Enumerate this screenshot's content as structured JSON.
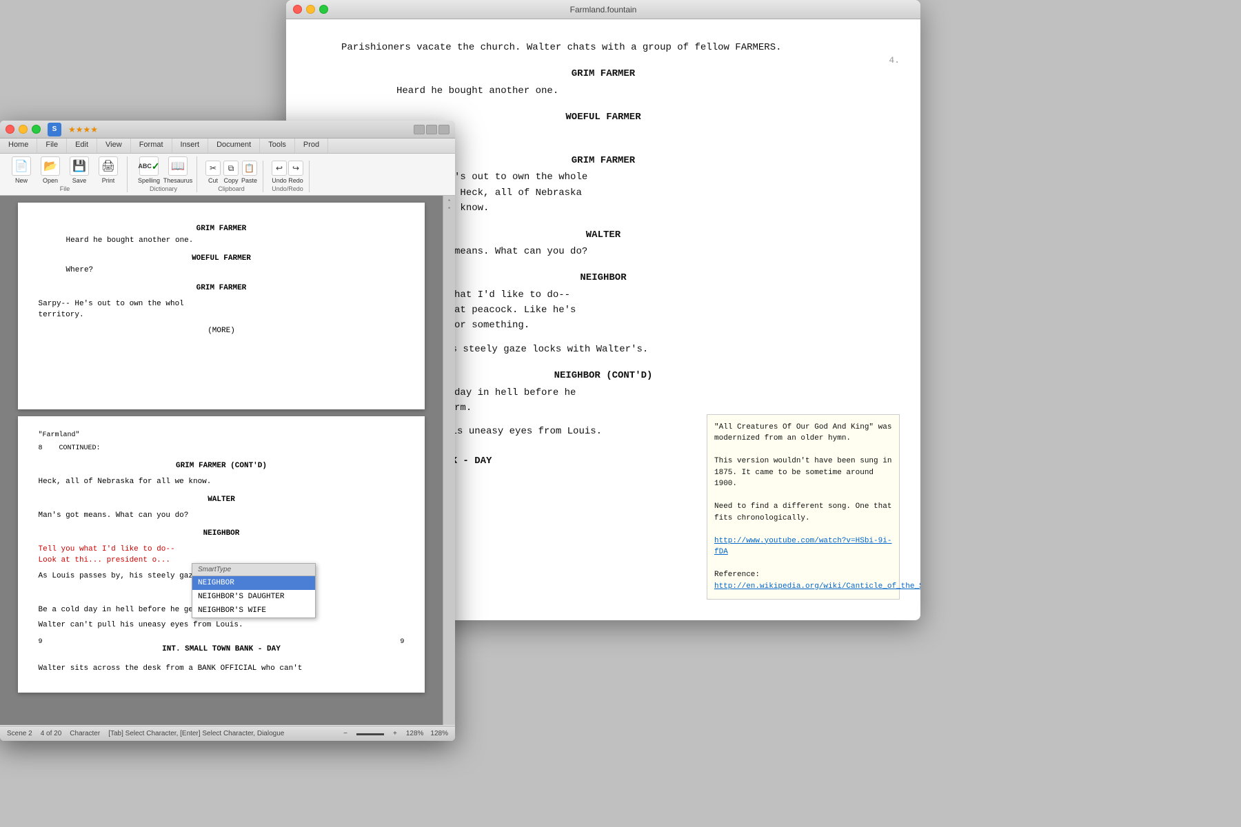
{
  "fountain_window": {
    "title": "Farmland.fountain",
    "page_number": "4.",
    "content": [
      {
        "type": "action",
        "text": "Parishioners vacate the church. Walter chats with a group of fellow FARMERS."
      },
      {
        "type": "char",
        "text": "GRIM FARMER"
      },
      {
        "type": "dialogue",
        "text": "Heard he bought another one."
      },
      {
        "type": "char",
        "text": "WOEFUL FARMER"
      },
      {
        "type": "dialogue",
        "text": "Where?"
      },
      {
        "type": "char",
        "text": "GRIM FARMER"
      },
      {
        "type": "dialogue",
        "text": "Sarpy-- He's out to own the whole territory. Heck, all of Nebraska for all we know."
      },
      {
        "type": "char",
        "text": "WALTER"
      },
      {
        "type": "dialogue",
        "text": "Man's got means. What can you do?"
      },
      {
        "type": "char",
        "text": "NEIGHBOR"
      },
      {
        "type": "dialogue",
        "text": "Tell you what I'd like to do-- Look at that peacock. Like he's president or something."
      },
      {
        "type": "action",
        "text": "Louis passes by. His steely gaze locks with Walter's."
      },
      {
        "type": "char",
        "text": "NEIGHBOR (CONT'D)"
      },
      {
        "type": "dialogue",
        "text": "Be a cold day in hell before he gets my farm."
      },
      {
        "type": "action",
        "text": "Walter can't pull his uneasy eyes from Louis."
      },
      {
        "type": "scene",
        "text": "INT. SMALL TOWN BANK - DAY"
      }
    ],
    "note": {
      "line1": "\"All Creatures Of Our God And King\" was modernized from an older hymn.",
      "line2": "This version wouldn't have been sung in 1875. It came to be sometime around 1900.",
      "line3": "Need to find a different song. One that fits chronologically.",
      "link1": "http://www.youtube.com/watch?v=HSbi-9i-fDA",
      "ref_label": "Reference:",
      "link2": "http://en.wikipedia.org/wiki/Canticle_of_the_Sun"
    }
  },
  "app_window": {
    "title": "",
    "icon_label": "S",
    "stars": "★★★★",
    "ribbon": {
      "tabs": [
        "Home",
        "File",
        "Edit",
        "View",
        "Format",
        "Insert",
        "Document",
        "Tools",
        "Prod"
      ],
      "active_tab": "Home",
      "groups": [
        {
          "name": "File",
          "buttons": [
            {
              "label": "New",
              "icon": "📄"
            },
            {
              "label": "Open",
              "icon": "📂"
            },
            {
              "label": "Save",
              "icon": "💾"
            },
            {
              "label": "Print",
              "icon": "🖨"
            }
          ]
        },
        {
          "name": "Dictionary",
          "buttons": [
            {
              "label": "Spelling",
              "icon": "ABC"
            },
            {
              "label": "Thesaurus",
              "icon": "📖"
            }
          ]
        },
        {
          "name": "Clipboard",
          "buttons": [
            {
              "label": "Cut",
              "icon": "✂"
            },
            {
              "label": "Copy",
              "icon": "📋"
            },
            {
              "label": "Paste",
              "icon": "📌"
            }
          ]
        },
        {
          "name": "Undo/Redo",
          "buttons": [
            {
              "label": "Undo",
              "icon": "↩"
            },
            {
              "label": "Redo",
              "icon": "↪"
            }
          ]
        }
      ]
    },
    "pages": [
      {
        "content": [
          {
            "type": "char",
            "text": "GRIM FARMER"
          },
          {
            "type": "dialogue",
            "text": "Heard he bought another one."
          },
          {
            "type": "char",
            "text": "WOEFUL FARMER"
          },
          {
            "type": "dialogue",
            "text": "Where?"
          },
          {
            "type": "char",
            "text": "GRIM FARMER"
          },
          {
            "type": "action",
            "text": "Sarpy-- He's out to own the whol territory."
          },
          {
            "type": "paren",
            "text": "(MORE)"
          }
        ]
      },
      {
        "label": "\"Farmland\"",
        "continued": "8    CONTINUED:",
        "content": [
          {
            "type": "char",
            "text": "GRIM FARMER (CONT'D)"
          },
          {
            "type": "action",
            "text": "Heck, all of Nebraska for all we know."
          },
          {
            "type": "char",
            "text": "WALTER"
          },
          {
            "type": "action",
            "text": "Man's got means. What can you do?"
          },
          {
            "type": "char",
            "text": "NEIGHBOR"
          },
          {
            "type": "highlight",
            "text": "Tell you what I'd like to do-- Look at thi... president o..."
          },
          {
            "type": "action",
            "text": "As Louis passes by, his steely gaze locks with Walter's."
          },
          {
            "type": "char",
            "text": "NEIGHBOR"
          },
          {
            "type": "action",
            "text": "Be a cold day in hell before he gets my farm."
          },
          {
            "type": "action",
            "text": "Walter can't pull his uneasy eyes from Louis."
          },
          {
            "type": "scene_num_left",
            "text": "9"
          },
          {
            "type": "scene",
            "text": "INT. SMALL TOWN BANK - DAY"
          },
          {
            "type": "scene_num_right",
            "text": "9"
          },
          {
            "type": "action",
            "text": "Walter sits across the desk from a BANK OFFICIAL who can't"
          }
        ]
      }
    ],
    "smarttype": {
      "header": "SmartType",
      "items": [
        "NEIGHBOR",
        "NEIGHBOR'S DAUGHTER",
        "NEIGHBOR'S WIFE"
      ],
      "selected": 0
    },
    "statusbar": {
      "scene": "Scene 2",
      "page_info": "4 of 20",
      "mode": "Character",
      "hint": "[Tab] Select Character, [Enter] Select Character, Dialogue",
      "zoom_value": "128%",
      "zoom_percent": "128%"
    },
    "side_markers": [
      "*",
      "*"
    ]
  }
}
